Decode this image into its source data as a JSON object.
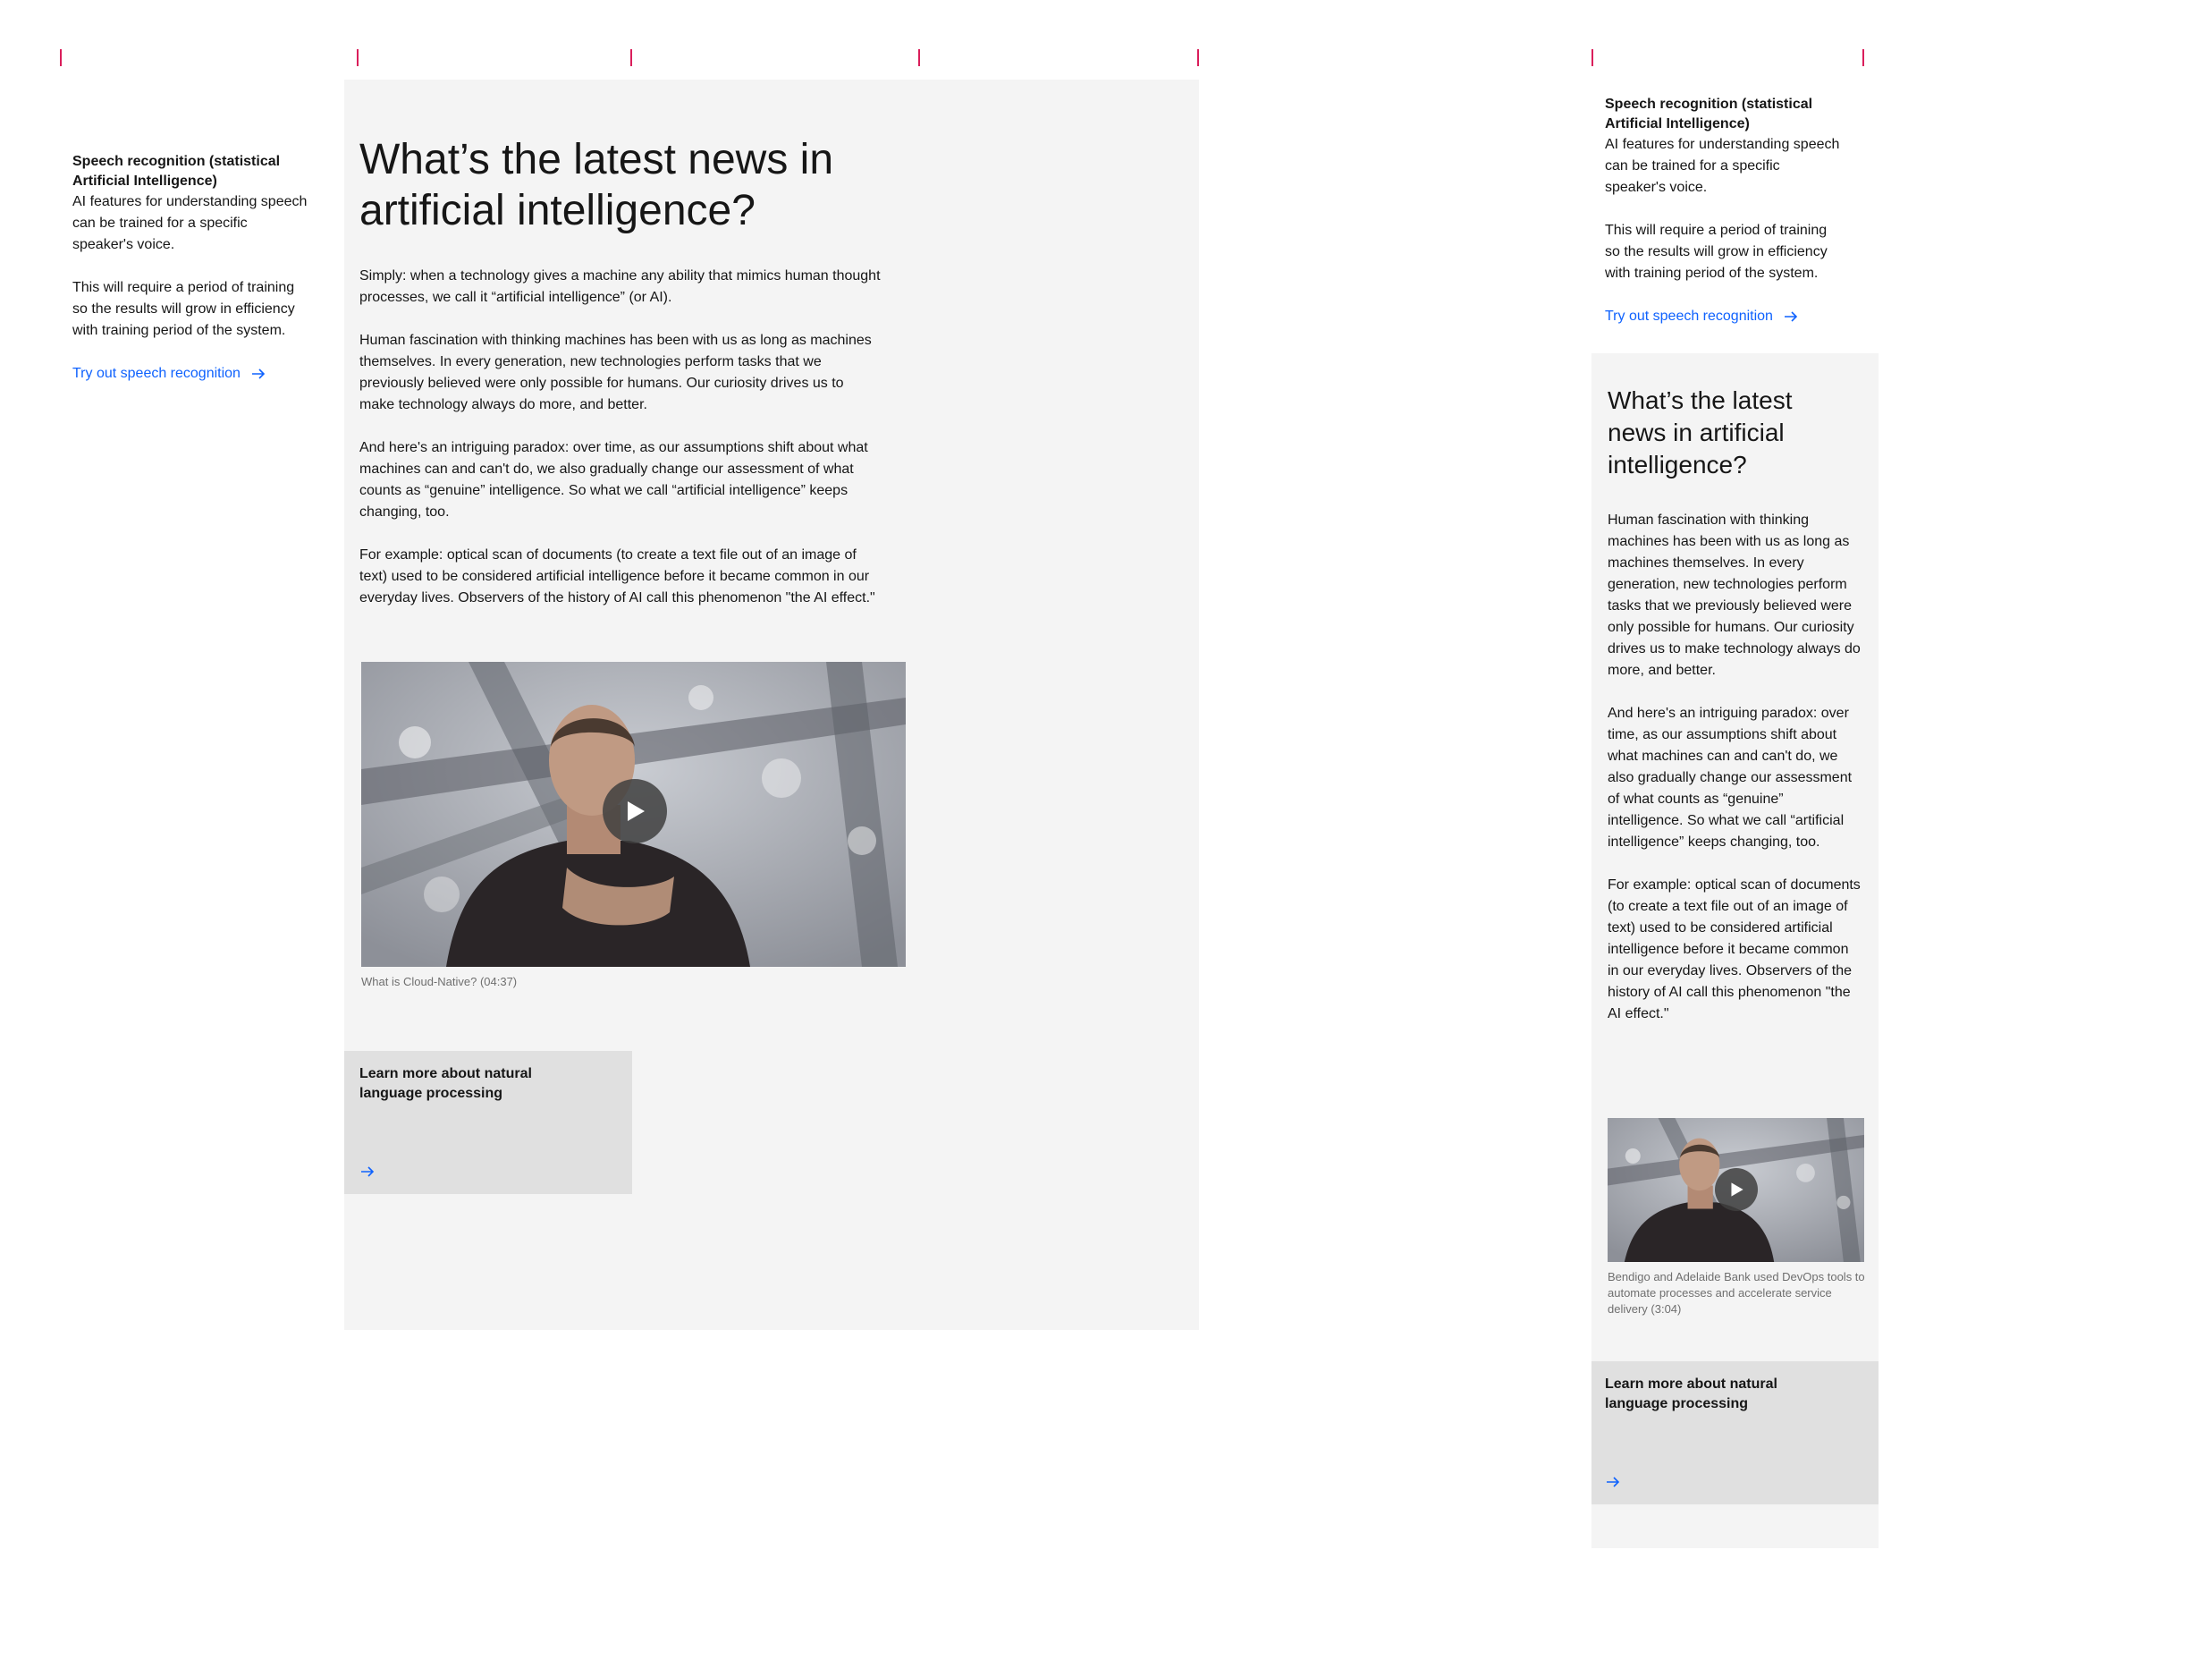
{
  "colors": {
    "tick": "#da1e5b",
    "link": "#0f62fe",
    "panel": "#f4f4f4",
    "card": "#e0e0e0",
    "text": "#161616",
    "caption": "#6f6f6f"
  },
  "sidebar": {
    "title": "Speech recognition (statistical Artificial Intelligence)",
    "body1": "AI features for understanding speech can be trained for a specific speaker's voice.",
    "body2": "This will require a period of training so the results will grow in efficiency with training period of the system.",
    "link": "Try out speech recognition",
    "link_icon": "arrow-right-icon"
  },
  "desktop": {
    "heading": "What’s the latest news in artificial intelligence?",
    "paragraphs": [
      "Simply: when a technology gives a machine any ability that mimics human thought processes, we call it “artificial intelligence” (or AI).",
      "Human fascination with thinking machines has been with us as long as machines themselves. In every generation, new technologies perform tasks that we previously believed were only possible for humans. Our curiosity drives us to make technology always do more, and better.",
      "And here's an intriguing paradox: over time, as our assumptions shift about what machines can and can't do, we also gradually change our assessment of what counts as “genuine” intelligence. So what we call “artificial intelligence” keeps changing, too.",
      "For example: optical scan of documents (to create a text file out of an image of text) used to be considered artificial intelligence before it became common in our everyday lives. Observers of the history of AI call this phenomenon \"the AI effect.\""
    ],
    "video_caption": "What is Cloud-Native? (04:37)",
    "video_icon": "play-icon",
    "card_title": "Learn more about natural language processing",
    "card_icon": "arrow-right-icon"
  },
  "mobile": {
    "heading": "What’s the latest news in artificial intelligence?",
    "paragraphs": [
      "Human fascination with thinking machines has been with us as long as machines themselves. In every generation, new technologies perform tasks that we previously believed were only possible for humans. Our curiosity drives us to make technology always do more, and better.",
      "And here's an intriguing paradox: over time, as our assumptions shift about what machines can and can't do, we also gradually change our assessment of what counts as “genuine” intelligence. So what we call “artificial intelligence” keeps changing, too.",
      "For example: optical scan of documents (to create a text file out of an image of text) used to be considered artificial intelligence before it became common in our everyday lives. Observers of the history of AI call this phenomenon \"the AI effect.\""
    ],
    "video_caption": "Bendigo and Adelaide Bank used DevOps tools to automate processes and accelerate service delivery (3:04)",
    "video_icon": "play-icon",
    "card_title": "Learn more about natural language processing",
    "card_icon": "arrow-right-icon"
  }
}
